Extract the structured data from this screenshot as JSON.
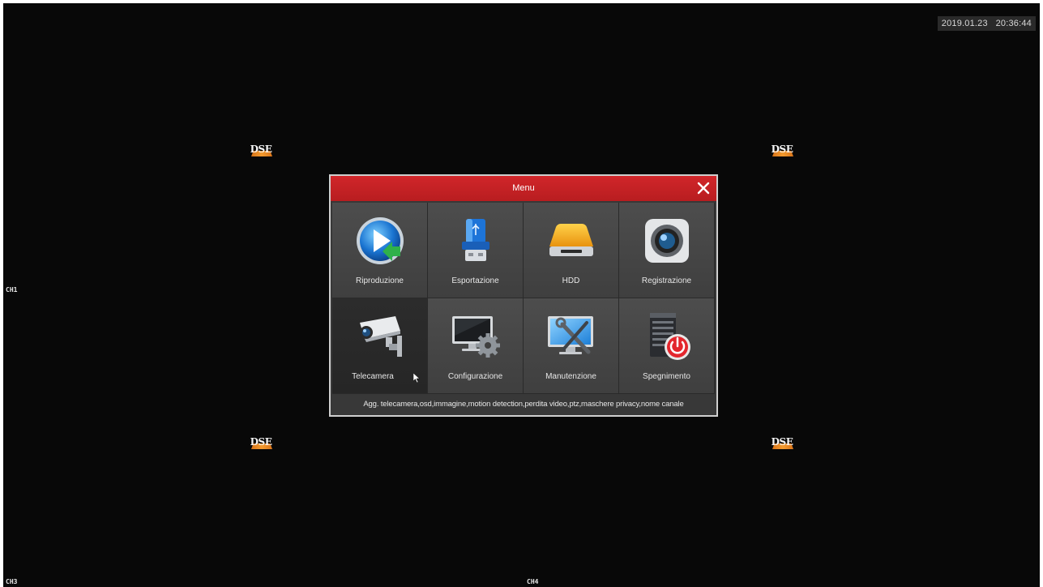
{
  "datetime": "2019.01.23   20:36:44",
  "channels": {
    "ch1": "CH1",
    "ch3": "CH3",
    "ch4": "CH4"
  },
  "logo_text": "DSE",
  "menu": {
    "title": "Menu",
    "close_icon": "close-icon",
    "items": [
      {
        "label": "Riproduzione",
        "icon": "play-icon"
      },
      {
        "label": "Esportazione",
        "icon": "usb-drive-icon"
      },
      {
        "label": "HDD",
        "icon": "hard-drive-icon"
      },
      {
        "label": "Registrazione",
        "icon": "record-camera-icon"
      },
      {
        "label": "Telecamera",
        "icon": "cctv-camera-icon"
      },
      {
        "label": "Configurazione",
        "icon": "monitor-gear-icon"
      },
      {
        "label": "Manutenzione",
        "icon": "monitor-tools-icon"
      },
      {
        "label": "Spegnimento",
        "icon": "server-power-icon"
      }
    ],
    "selected": "Telecamera",
    "description": "Agg. telecamera,osd,immagine,motion detection,perdita video,ptz,maschere privacy,nome canale"
  },
  "colors": {
    "titlebar": "#c8222a",
    "background": "#080808",
    "accent_orange": "#f39a2e"
  }
}
